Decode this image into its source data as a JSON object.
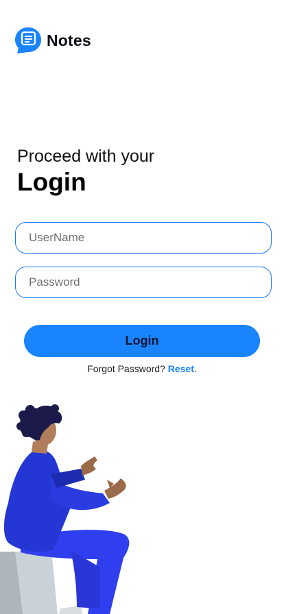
{
  "app": {
    "name": "Notes",
    "brand_color": "#1a84ff"
  },
  "logo": {
    "icon": "chat-note-icon"
  },
  "heading": {
    "subtitle": "Proceed with your",
    "title": "Login"
  },
  "form": {
    "username_placeholder": "UserName",
    "password_placeholder": "Password",
    "login_label": "Login"
  },
  "forgot": {
    "text": "Forgot Password? ",
    "link_label": "Reset",
    "suffix": "."
  },
  "illustration": {
    "icon": "person-sitting-illustration"
  }
}
